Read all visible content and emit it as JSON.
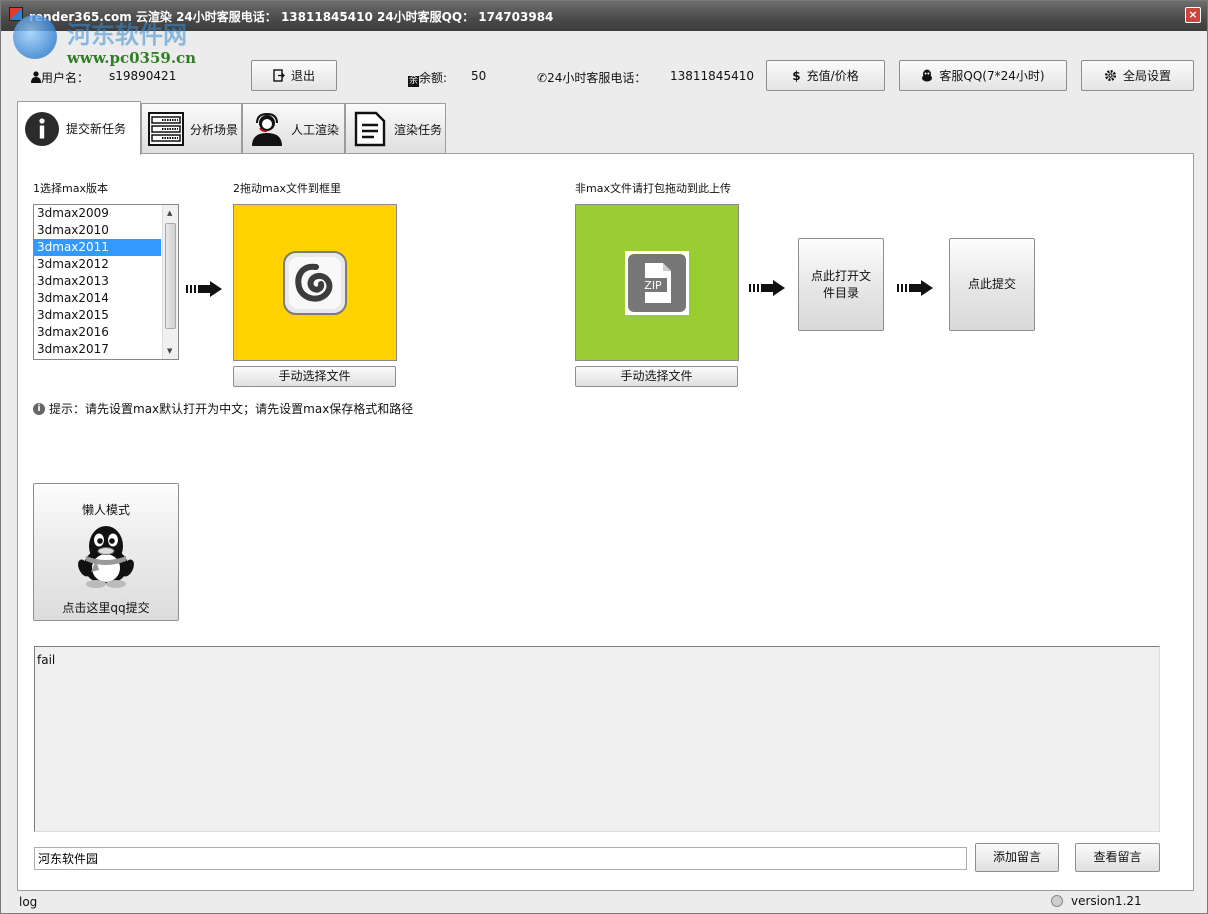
{
  "titlebar": {
    "title": "render365.com 云渲染  24小时客服电话： 13811845410   24小时客服QQ： 174703984",
    "close": "×"
  },
  "watermark": {
    "title": "河东软件网",
    "url": "www.pc0359.cn"
  },
  "info": {
    "user_label": "用户名：",
    "user_value": "s19890421",
    "logout_label": "退出",
    "balance_label": "余额:",
    "balance_value": "50",
    "phone_label": "24小时客服电话：",
    "phone_value": "13811845410",
    "recharge_label": "充值/价格",
    "recharge_icon": "$",
    "qq_label": "客服QQ(7*24小时)",
    "settings_label": "全局设置"
  },
  "tabs": [
    {
      "label": "提交新任务",
      "icon": "info-icon"
    },
    {
      "label": "分析场景",
      "icon": "server-icon"
    },
    {
      "label": "人工渲染",
      "icon": "support-agent-icon"
    },
    {
      "label": "渲染任务",
      "icon": "document-list-icon"
    }
  ],
  "main": {
    "step1_label": "1选择max版本",
    "step2_label": "2拖动max文件到框里",
    "nonmax_label": "非max文件请打包拖动到此上传",
    "versions": [
      "3dmax2009",
      "3dmax2010",
      "3dmax2011",
      "3dmax2012",
      "3dmax2013",
      "3dmax2014",
      "3dmax2015",
      "3dmax2016",
      "3dmax2017"
    ],
    "selected_version": "3dmax2011",
    "manual_select_1": "手动选择文件",
    "manual_select_2": "手动选择文件",
    "open_dir_label": "点此打开文件目录",
    "submit_label": "点此提交",
    "hint": "提示：请先设置max默认打开为中文；请先设置max保存格式和路径",
    "zip_label": "ZIP",
    "lazy_title": "懒人模式",
    "lazy_sub": "点击这里qq提交",
    "log_text": "fail",
    "message_value": "河东软件园",
    "add_msg_label": "添加留言",
    "view_msg_label": "查看留言"
  },
  "colors": {
    "max_drop_bg": "#ffd200",
    "zip_drop_bg": "#9acd32",
    "selection": "#3399ff"
  },
  "statusbar": {
    "log_label": "log",
    "version": "version1.21"
  }
}
